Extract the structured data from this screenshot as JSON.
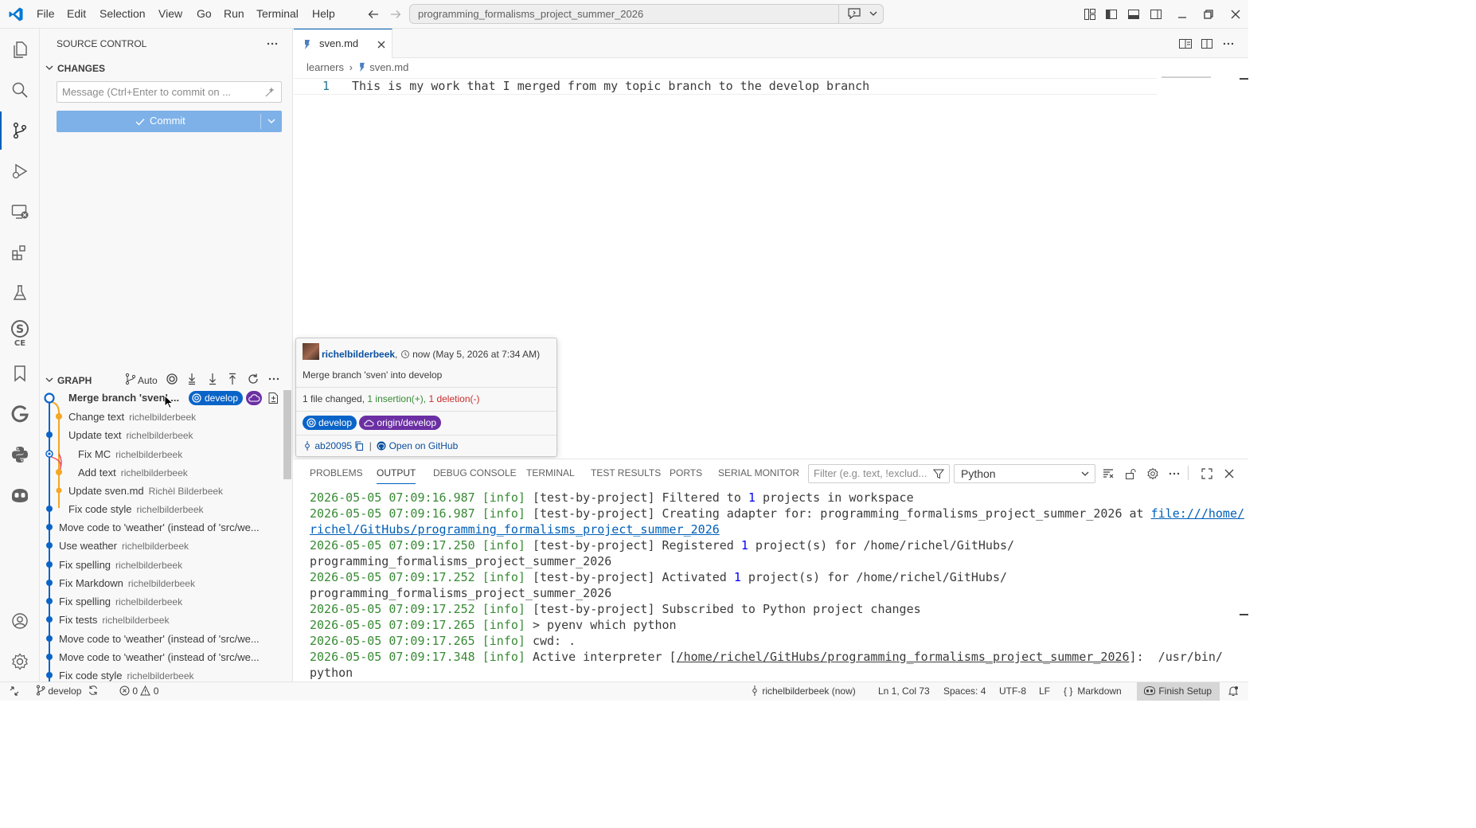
{
  "titlebar": {
    "menu": [
      "File",
      "Edit",
      "Selection",
      "View",
      "Go",
      "Run",
      "Terminal",
      "Help"
    ],
    "command_center": "programming_formalisms_project_summer_2026"
  },
  "sidebar": {
    "title": "SOURCE CONTROL",
    "changes_label": "CHANGES",
    "commit_placeholder": "Message (Ctrl+Enter to commit on ...",
    "commit_label": "Commit",
    "graph": {
      "title": "GRAPH",
      "auto_label": "Auto",
      "commits": [
        {
          "message": "Merge branch 'sven' ...",
          "author": "",
          "badge": "develop"
        },
        {
          "message": "Change text",
          "author": "richelbilderbeek"
        },
        {
          "message": "Update text",
          "author": "richelbilderbeek"
        },
        {
          "message": "Fix MC",
          "author": "richelbilderbeek"
        },
        {
          "message": "Add text",
          "author": "richelbilderbeek"
        },
        {
          "message": "Update sven.md",
          "author": "Richèl Bilderbeek"
        },
        {
          "message": "Fix code style",
          "author": "richelbilderbeek"
        },
        {
          "message": "Move code to 'weather' (instead of 'src/we...",
          "author": ""
        },
        {
          "message": "Use weather",
          "author": "richelbilderbeek"
        },
        {
          "message": "Fix spelling",
          "author": "richelbilderbeek"
        },
        {
          "message": "Fix Markdown",
          "author": "richelbilderbeek"
        },
        {
          "message": "Fix spelling",
          "author": "richelbilderbeek"
        },
        {
          "message": "Fix tests",
          "author": "richelbilderbeek"
        },
        {
          "message": "Move code to 'weather' (instead of 'src/we...",
          "author": ""
        },
        {
          "message": "Move code to 'weather' (instead of 'src/we...",
          "author": ""
        },
        {
          "message": "Fix code style",
          "author": "richelbilderbeek"
        }
      ]
    }
  },
  "editor": {
    "tab_label": "sven.md",
    "breadcrumb": [
      "learners",
      "sven.md"
    ],
    "line_number": "1",
    "line_text": "This is my work that I merged from my topic branch to the develop branch"
  },
  "hover": {
    "author": "richelbilderbeek",
    "time": "now (May 5, 2026 at 7:34 AM)",
    "message": "Merge branch 'sven' into develop",
    "files_changed": "1 file changed,",
    "insertions": "1 insertion(+),",
    "deletions": "1 deletion(-)",
    "badge_local": "develop",
    "badge_remote": "origin/develop",
    "hash": "ab20095",
    "separator": "|",
    "open_link": "Open on GitHub"
  },
  "panel": {
    "tabs": [
      "PROBLEMS",
      "OUTPUT",
      "DEBUG CONSOLE",
      "TERMINAL",
      "TEST RESULTS",
      "PORTS",
      "SERIAL MONITOR"
    ],
    "active_tab": "OUTPUT",
    "filter_placeholder": "Filter (e.g. text, !exclud...",
    "channel": "Python",
    "log": [
      {
        "ts": "2026-05-05 07:09:16.987",
        "level": "[info]",
        "a": " [test-by-project] Filtered to ",
        "num": "1",
        "b": " projects in workspace"
      },
      {
        "ts": "2026-05-05 07:09:16.987",
        "level": "[info]",
        "a": " [test-by-project] Creating adapter for: programming_formalisms_project_summer_2026 at ",
        "link": "file:///home/",
        "link2": "richel/GitHubs/programming_formalisms_project_summer_2026"
      },
      {
        "ts": "2026-05-05 07:09:17.250",
        "level": "[info]",
        "a": " [test-by-project] Registered ",
        "num": "1",
        "b": " project(s) for /home/richel/GitHubs/",
        "cont": "programming_formalisms_project_summer_2026"
      },
      {
        "ts": "2026-05-05 07:09:17.252",
        "level": "[info]",
        "a": " [test-by-project] Activated ",
        "num": "1",
        "b": " project(s) for /home/richel/GitHubs/",
        "cont": "programming_formalisms_project_summer_2026"
      },
      {
        "ts": "2026-05-05 07:09:17.252",
        "level": "[info]",
        "a": " [test-by-project] Subscribed to Python project changes"
      },
      {
        "ts": "2026-05-05 07:09:17.265",
        "level": "[info]",
        "a": " > pyenv which python"
      },
      {
        "ts": "2026-05-05 07:09:17.265",
        "level": "[info]",
        "a": " cwd: ."
      },
      {
        "ts": "2026-05-05 07:09:17.348",
        "level": "[info]",
        "a": " Active interpreter [",
        "path": "/home/richel/GitHubs/programming_formalisms_project_summer_2026",
        "b": "]:  /usr/bin/",
        "cont": "python"
      }
    ]
  },
  "statusbar": {
    "branch": "develop",
    "errors": "0",
    "warnings": "0",
    "blame": "richelbilderbeek (now)",
    "position": "Ln 1, Col 73",
    "spaces": "Spaces: 4",
    "encoding": "UTF-8",
    "eol": "LF",
    "language": "Markdown",
    "finish_setup": "Finish Setup"
  },
  "colors": {
    "accent": "#005fb8",
    "develop_badge": "#0a64c8",
    "remote_badge": "#6b2fa3",
    "graph_orange": "#f5a623",
    "graph_red": "#e8475f"
  }
}
